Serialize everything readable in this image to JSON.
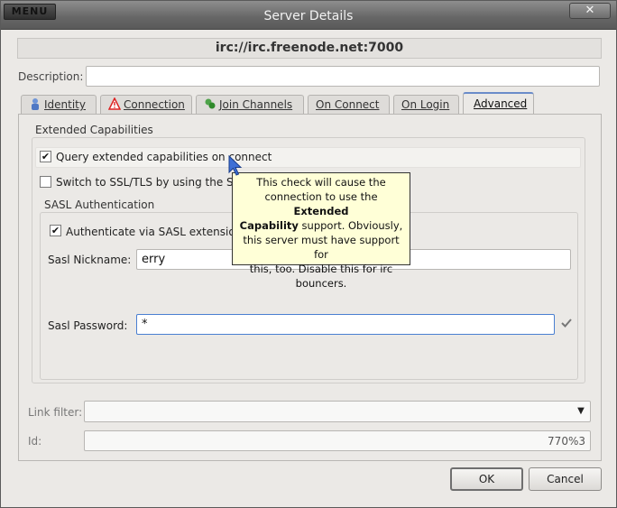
{
  "window": {
    "menu_label": "MENU",
    "title": "Server Details",
    "close_glyph": "✕"
  },
  "server": {
    "address": "irc://irc.freenode.net:7000"
  },
  "description": {
    "label": "Description:",
    "value": ""
  },
  "tabs": [
    {
      "label": "Identity",
      "icon": "identity-icon",
      "active": false
    },
    {
      "label": "Connection",
      "icon": "warning-icon",
      "active": false
    },
    {
      "label": "Join Channels",
      "icon": "join-channels-icon",
      "active": false
    },
    {
      "label": "On Connect",
      "icon": null,
      "active": false
    },
    {
      "label": "On Login",
      "icon": null,
      "active": false
    },
    {
      "label": "Advanced",
      "icon": null,
      "active": true
    }
  ],
  "extended": {
    "group_label": "Extended Capabilities",
    "query_label": "Query extended capabilities on connect",
    "query_checked": true,
    "ssl_label": "Switch to SSL/TLS by using the S",
    "ssl_checked": false
  },
  "sasl": {
    "group_label": "SASL Authentication",
    "auth_label": "Authenticate via SASL extensio",
    "auth_checked": true,
    "nickname_label": "Sasl Nickname:",
    "nickname_value": "erry",
    "password_label": "Sasl Password:",
    "password_value": "*"
  },
  "tooltip": {
    "line1": "This check will cause the",
    "line2_pre": "connection to use the ",
    "line2_bold": "Extended",
    "line3_bold": "Capability",
    "line3_post": " support. Obviously,",
    "line4": "this server must have support for",
    "line5": "this, too. Disable this for irc",
    "line6": "bouncers."
  },
  "link_filter": {
    "label": "Link filter:",
    "value": ""
  },
  "id_field": {
    "label": "Id:",
    "value": "770%3"
  },
  "buttons": {
    "ok": "OK",
    "cancel": "Cancel"
  },
  "colors": {
    "tooltip_bg": "#ffffd7",
    "active_tab_accent": "#6a8cc9"
  }
}
